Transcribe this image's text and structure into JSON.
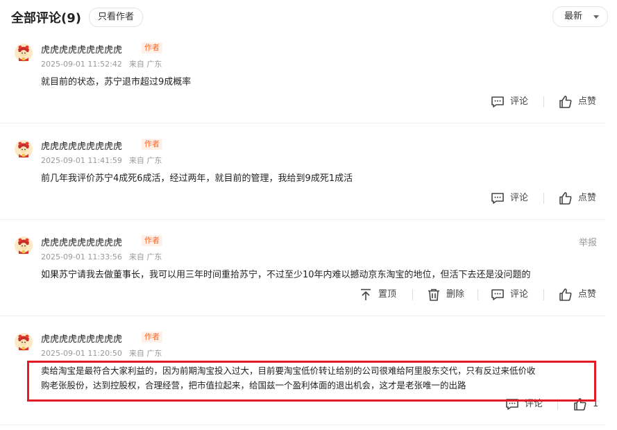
{
  "header": {
    "title": "全部评论(9)",
    "only_author": "只看作者",
    "sort": "最新"
  },
  "comments": [
    {
      "name": "虎虎虎虎虎虎虎虎虎",
      "tag": "作者",
      "time": "2025-09-01 11:52:42",
      "location": "来自 广东",
      "content": "就目前的状态，苏宁退市超过9成概率",
      "comment_label": "评论",
      "like_label": "点赞"
    },
    {
      "name": "虎虎虎虎虎虎虎虎虎",
      "tag": "作者",
      "time": "2025-09-01 11:41:59",
      "location": "来自 广东",
      "content": "前几年我评价苏宁4成死6成活，经过两年，就目前的管理，我给到9成死1成活",
      "comment_label": "评论",
      "like_label": "点赞"
    },
    {
      "name": "虎虎虎虎虎虎虎虎虎",
      "tag": "作者",
      "time": "2025-09-01 11:33:56",
      "location": "来自 广东",
      "report": "举报",
      "content": "如果苏宁请我去做董事长，我可以用三年时间重拾苏宁，不过至少10年内难以撼动京东淘宝的地位，但活下去还是没问题的",
      "pin_label": "置顶",
      "delete_label": "删除",
      "comment_label": "评论",
      "like_label": "点赞"
    },
    {
      "name": "虎虎虎虎虎虎虎虎虎",
      "tag": "作者",
      "time": "2025-09-01 11:20:50",
      "location": "来自 广东",
      "content_line1": "卖给淘宝是最符合大家利益的，因为前期淘宝投入过大，目前要淘宝低价转让给别的公司很难给阿里股东交代，只有反过来低价收",
      "content_line2": "购老张股份，达到控股权，合理经营，把市值拉起来，给国兹一个盈利体面的退出机会，这才是老张唯一的出路",
      "comment_label": "评论",
      "like_count": "1"
    }
  ],
  "colors": {
    "author_tag": "#ff6a2b",
    "highlight_border": "#e21a23"
  }
}
